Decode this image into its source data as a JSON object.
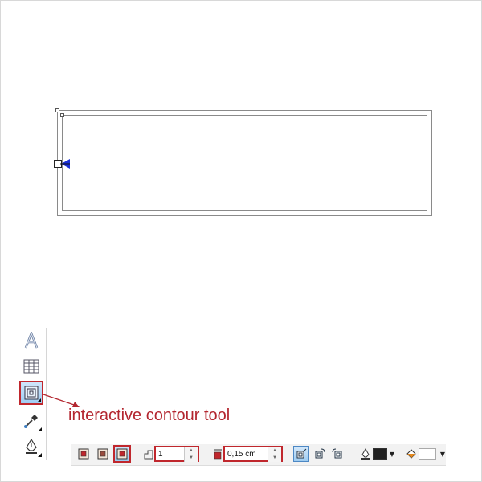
{
  "canvas": {
    "shape": "rectangle-with-contour"
  },
  "annotation": {
    "text": "interactive contour tool",
    "color": "#b3262f"
  },
  "toolbox": {
    "tools": [
      {
        "name": "artistic-text-icon",
        "active": false
      },
      {
        "name": "table-icon",
        "active": false
      },
      {
        "name": "contour-icon",
        "active": true
      },
      {
        "name": "eyedropper-icon",
        "active": false
      },
      {
        "name": "outline-pen-icon",
        "active": false
      }
    ]
  },
  "propbar": {
    "steps_value": "1",
    "offset_value": "0,15 cm",
    "outline_color": "#222222",
    "fill_color": "#ffffff"
  }
}
